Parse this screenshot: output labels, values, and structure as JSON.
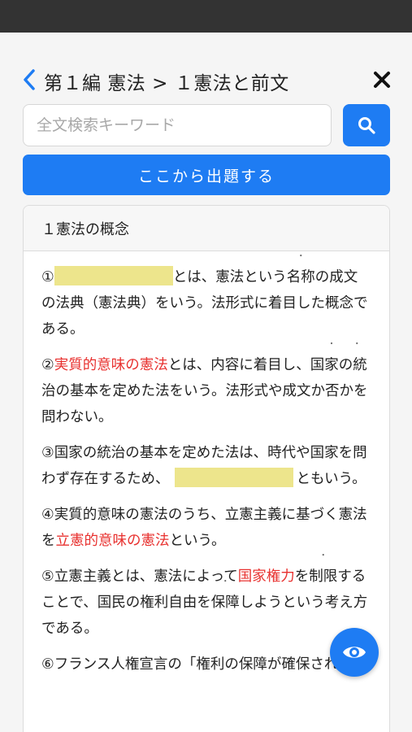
{
  "header": {
    "breadcrumb": "第１編 憲法 > １憲法と前文",
    "back_icon": "chevron-left-icon",
    "close_icon": "close-icon"
  },
  "search": {
    "placeholder": "全文検索キーワード",
    "value": "",
    "icon": "search-icon"
  },
  "actions": {
    "start_label": "ここから出題する"
  },
  "section": {
    "title": "１憲法の概念",
    "paragraphs": {
      "p1_num": "①",
      "p1_a": "とは、憲法という",
      "p1_dot": "名称",
      "p1_b": "の成文の法典（憲法典）をいう。法形式に着目した概念である。",
      "p2_num": "②",
      "p2_red": "実質的意味の憲法",
      "p2_a": "とは、内容に着目し、",
      "p2_dot1": "国家の",
      "p2_dot2": "統治の基本",
      "p2_b": "を定めた法をいう。法形式や成文か否かを問わない。",
      "p3_a": "③国家の統治の基本を定めた法は、時代や国家を問わず存在するため、",
      "p3_b": "ともいう。",
      "p4_a": "④実質的意味の憲法のうち、立憲主義に基づく憲法を",
      "p4_red": "立憲的意味の憲法",
      "p4_b": "という。",
      "p5_a": "⑤立憲主義とは、憲法によって",
      "p5_red": "国家権力",
      "p5_b": "を",
      "p5_dot1": "制限",
      "p5_c": "することで、国民の権利自由を",
      "p5_dot2": "保障",
      "p5_d": "しようという考え方である。",
      "p6_a": "⑥フランス人権宣言の「権利の保障が確保され"
    }
  },
  "fab": {
    "icon": "eye-icon"
  },
  "colors": {
    "accent": "#1e7cf3",
    "highlight_red": "#e8312f",
    "blank_fill": "#ede58c",
    "status_bar": "#333333"
  }
}
